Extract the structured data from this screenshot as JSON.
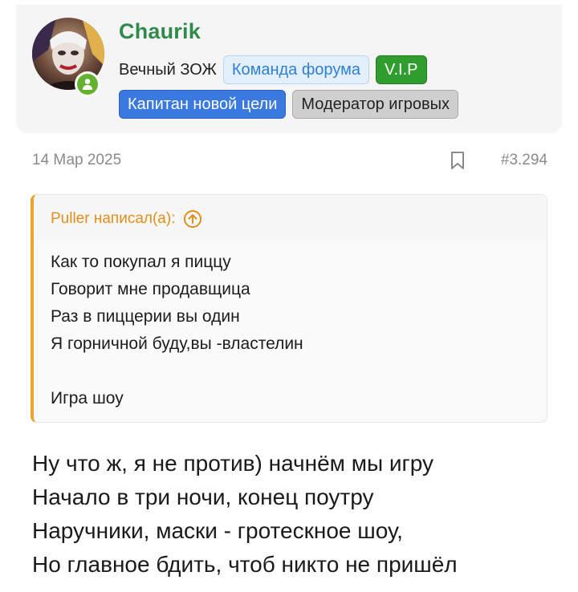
{
  "author": {
    "username": "Chaurik",
    "user_title": "Вечный ЗОЖ",
    "badges": [
      "Команда форума",
      "V.I.P",
      "Капитан новой цели",
      "Модератор игровых"
    ],
    "online": true,
    "colors": {
      "username": "#2f8a4c",
      "online": "#63b12f",
      "team": "#2f7fd3",
      "vip": "#2f9e2f",
      "captain": "#3a79e0",
      "moderator": "#cfcfcf"
    }
  },
  "post": {
    "date": "14 Мар 2025",
    "number": "#3.294",
    "quote": {
      "author_line": "Puller написал(а):",
      "lines": [
        "Как то покупал я пиццу",
        "Говорит мне продавщица",
        "Раз в пиццерии вы один",
        "Я горничной буду,вы -властелин",
        "",
        "Игра шоу"
      ],
      "accent_color": "#f0a32b"
    },
    "message_lines": [
      "Ну что ж, я не против) начнём мы игру",
      "Начало в три ночи, конец поутру",
      "Наручники, маски - гротескное шоу,",
      "Но главное бдить, чтоб никто не пришёл"
    ]
  },
  "icons": {
    "bookmark": "bookmark-icon",
    "online": "online-person-icon",
    "quote_jump": "arrow-up-circle-icon"
  }
}
